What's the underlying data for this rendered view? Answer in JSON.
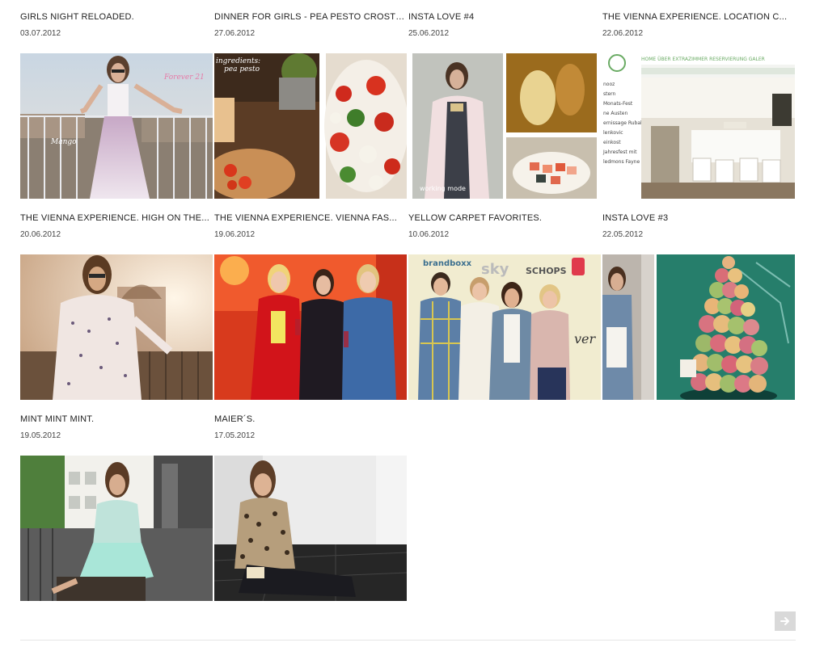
{
  "posts": [
    {
      "title": "GIRLS NIGHT RELOADED.",
      "date": "03.07.2012",
      "image": "girl-balcony-sunglasses-photo"
    },
    {
      "title": "DINNER FOR GIRLS - PEA PESTO CROSTINI",
      "date": "27.06.2012",
      "image": "pea-pesto-crostini-collage"
    },
    {
      "title": "INSTA LOVE #4",
      "date": "25.06.2012",
      "image": "instagram-collage"
    },
    {
      "title": "THE VIENNA EXPERIENCE. LOCATION C...",
      "date": "22.06.2012",
      "image": "restaurant-website-screenshot"
    },
    {
      "title": "THE VIENNA EXPERIENCE. HIGH ON THE...",
      "date": "20.06.2012",
      "image": "girl-rooftop-sunset-photo"
    },
    {
      "title": "THE VIENNA EXPERIENCE. VIENNA FAS...",
      "date": "19.06.2012",
      "image": "three-women-event-photo"
    },
    {
      "title": "YELLOW CARPET FAVORITES.",
      "date": "10.06.2012",
      "image": "yellow-carpet-group-photo"
    },
    {
      "title": "INSTA LOVE #3",
      "date": "22.05.2012",
      "image": "macaron-tower-collage"
    },
    {
      "title": "MINT MINT MINT.",
      "date": "19.05.2012",
      "image": "girl-mint-outfit-photo"
    },
    {
      "title": "MAIER´S.",
      "date": "17.05.2012",
      "image": "girl-leopard-blouse-photo"
    }
  ],
  "pagination": {
    "next_icon": "arrow-right-icon"
  },
  "colors": {
    "title": "#222222",
    "date": "#444444",
    "arrow_bg": "#d9d9d9"
  }
}
